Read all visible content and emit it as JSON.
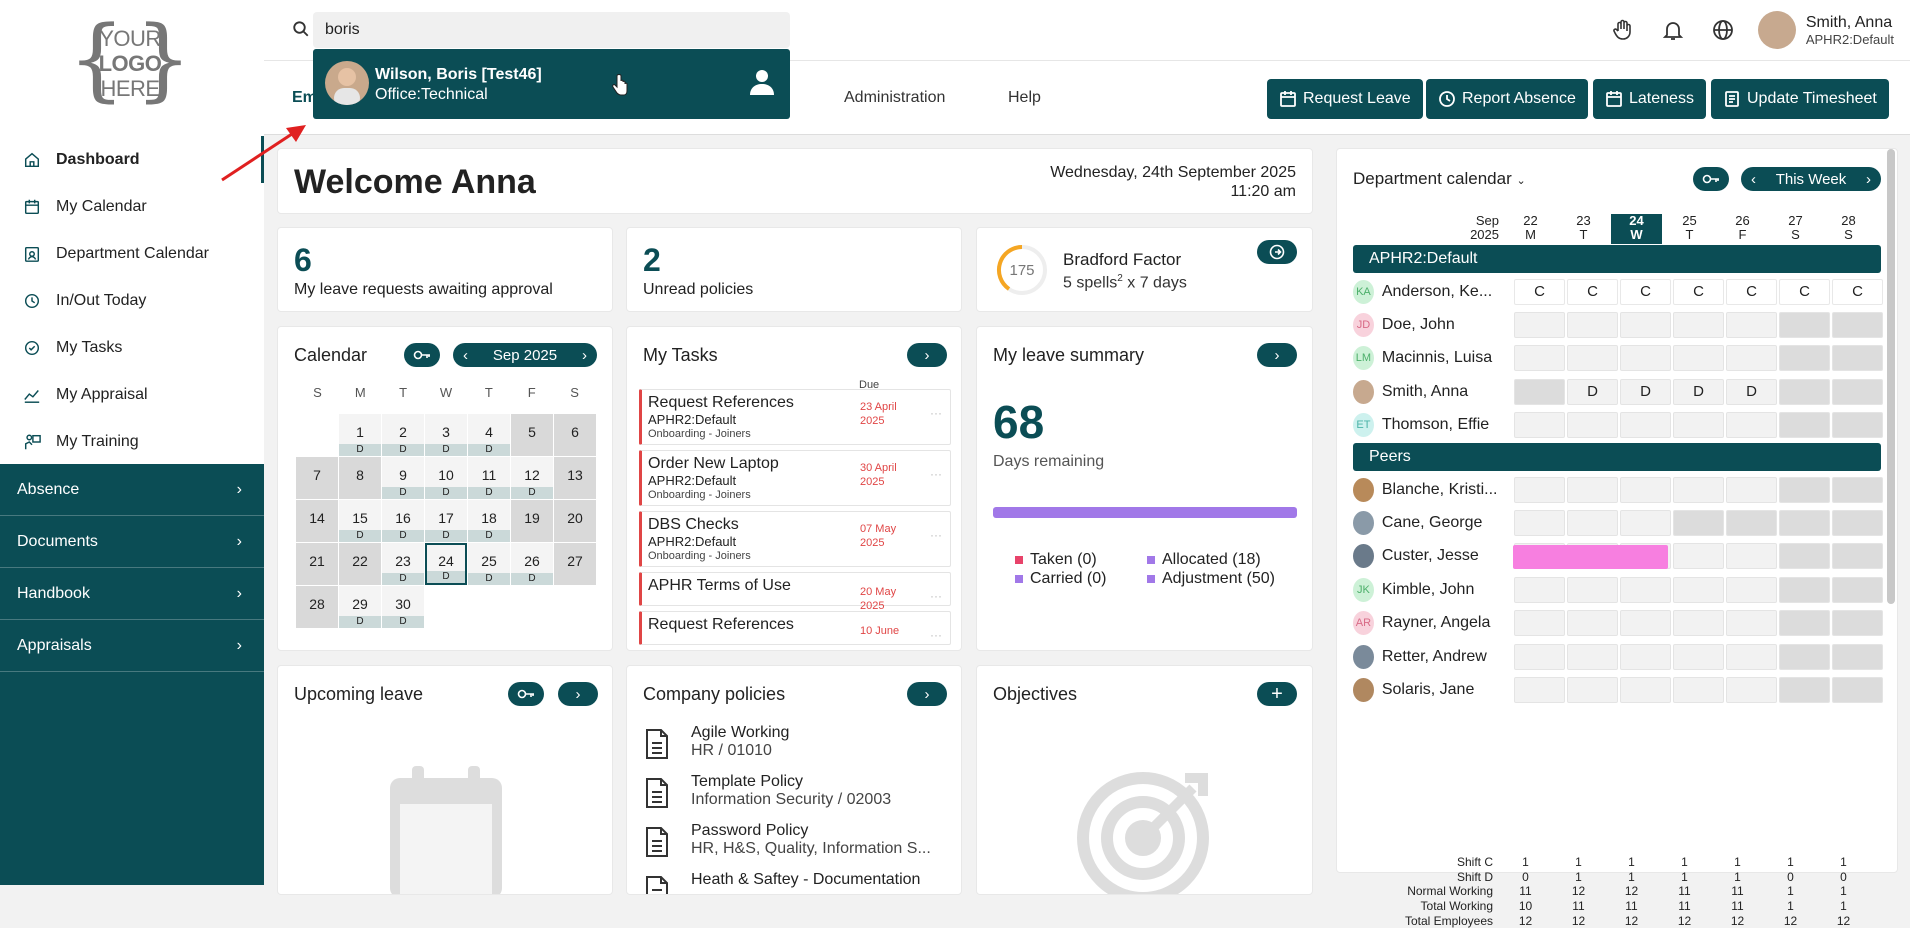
{
  "logo": {
    "line1": "YOUR",
    "line2": "LOGO",
    "line3": "HERE"
  },
  "sidebar": {
    "items": [
      {
        "label": "Dashboard",
        "icon": "home-icon",
        "active": true
      },
      {
        "label": "My Calendar",
        "icon": "calendar-icon"
      },
      {
        "label": "Department Calendar",
        "icon": "calendar-user-icon"
      },
      {
        "label": "In/Out Today",
        "icon": "history-icon"
      },
      {
        "label": "My Tasks",
        "icon": "check-circle-icon"
      },
      {
        "label": "My Appraisal",
        "icon": "chart-line-icon"
      },
      {
        "label": "My Training",
        "icon": "training-icon"
      }
    ],
    "sections": [
      "Absence",
      "Documents",
      "Handbook",
      "Appraisals"
    ]
  },
  "search": {
    "value": "boris"
  },
  "search_result": {
    "name": "Wilson, Boris [Test46]",
    "sub": "Office:Technical"
  },
  "user": {
    "name": "Smith, Anna",
    "role": "APHR2:Default"
  },
  "tabs": {
    "first_partial": "Em",
    "admin": "Administration",
    "help": "Help"
  },
  "actions": [
    "Request Leave",
    "Report Absence",
    "Lateness",
    "Update Timesheet"
  ],
  "welcome": {
    "title": "Welcome Anna",
    "date": "Wednesday, 24th September 2025",
    "time": "11:20 am"
  },
  "stats": {
    "leave_count": "6",
    "leave_label": "My leave requests awaiting approval",
    "policies_count": "2",
    "policies_label": "Unread policies",
    "bradford_score": "175",
    "bradford_title": "Bradford Factor",
    "bradford_spells": "5 spells",
    "bradford_sup": "2",
    "bradford_rest": " x 7 days"
  },
  "calendar": {
    "title": "Calendar",
    "month": "Sep 2025",
    "headers": [
      "S",
      "M",
      "T",
      "W",
      "T",
      "F",
      "S"
    ],
    "weeks": [
      [
        {
          "n": ""
        },
        {
          "n": "1",
          "d": true
        },
        {
          "n": "2",
          "d": true
        },
        {
          "n": "3",
          "d": true
        },
        {
          "n": "4",
          "d": true
        },
        {
          "n": "5",
          "we": true
        },
        {
          "n": "6",
          "we": true
        }
      ],
      [
        {
          "n": "7",
          "we": true
        },
        {
          "n": "8",
          "we": true
        },
        {
          "n": "9",
          "d": true
        },
        {
          "n": "10",
          "d": true
        },
        {
          "n": "11",
          "d": true
        },
        {
          "n": "12",
          "d": true
        },
        {
          "n": "13",
          "we": true
        }
      ],
      [
        {
          "n": "14",
          "we": true
        },
        {
          "n": "15",
          "d": true
        },
        {
          "n": "16",
          "d": true
        },
        {
          "n": "17",
          "d": true
        },
        {
          "n": "18",
          "d": true
        },
        {
          "n": "19",
          "we": true
        },
        {
          "n": "20",
          "we": true
        }
      ],
      [
        {
          "n": "21",
          "we": true
        },
        {
          "n": "22",
          "we": true
        },
        {
          "n": "23",
          "d": true
        },
        {
          "n": "24",
          "d": true,
          "today": true
        },
        {
          "n": "25",
          "d": true
        },
        {
          "n": "26",
          "d": true
        },
        {
          "n": "27",
          "we": true
        }
      ],
      [
        {
          "n": "28",
          "we": true
        },
        {
          "n": "29",
          "d": true
        },
        {
          "n": "30",
          "d": true
        },
        {
          "n": ""
        },
        {
          "n": ""
        },
        {
          "n": ""
        },
        {
          "n": ""
        }
      ]
    ],
    "day_marker": "D"
  },
  "tasks": {
    "title": "My Tasks",
    "due_label": "Due",
    "items": [
      {
        "title": "Request References",
        "sub": "APHR2:Default",
        "sub2": "Onboarding - Joiners",
        "due": "23 April 2025"
      },
      {
        "title": "Order New Laptop",
        "sub": "APHR2:Default",
        "sub2": "Onboarding - Joiners",
        "due": "30 April 2025"
      },
      {
        "title": "DBS Checks",
        "sub": "APHR2:Default",
        "sub2": "Onboarding - Joiners",
        "due": "07 May 2025"
      },
      {
        "title": "APHR Terms of Use",
        "sub": "",
        "sub2": "",
        "due": "20 May 2025"
      },
      {
        "title": "Request References",
        "sub": "",
        "sub2": "",
        "due": "10 June"
      }
    ]
  },
  "leave_summary": {
    "title": "My leave summary",
    "days": "68",
    "days_label": "Days remaining",
    "taken": "Taken (0)",
    "carried": "Carried (0)",
    "allocated": "Allocated (18)",
    "adjustment": "Adjustment (50)",
    "colors": {
      "taken": "#e8436a",
      "carried": "#a178e8",
      "allocated": "#a178e8",
      "adjustment": "#a178e8",
      "bar": "#a178e8"
    }
  },
  "upcoming": {
    "title": "Upcoming leave"
  },
  "policies": {
    "title": "Company policies",
    "items": [
      {
        "title": "Agile Working",
        "sub": "HR / 01010"
      },
      {
        "title": "Template Policy",
        "sub": "Information Security / 02003"
      },
      {
        "title": "Password Policy",
        "sub": "HR, H&S, Quality, Information S..."
      },
      {
        "title": "Heath & Saftey - Documentation",
        "sub": ""
      }
    ]
  },
  "objectives": {
    "title": "Objectives"
  },
  "dept": {
    "title": "Department calendar",
    "range": "This Week",
    "month": "Sep",
    "year": "2025",
    "days": [
      {
        "n": "22",
        "l": "M"
      },
      {
        "n": "23",
        "l": "T"
      },
      {
        "n": "24",
        "l": "W",
        "today": true
      },
      {
        "n": "25",
        "l": "T"
      },
      {
        "n": "26",
        "l": "F"
      },
      {
        "n": "27",
        "l": "S"
      },
      {
        "n": "28",
        "l": "S"
      }
    ],
    "group1": "APHR2:Default",
    "group1_rows": [
      {
        "name": "Anderson, Ke...",
        "ini": "KA",
        "bg": "#cdf1d7",
        "fg": "#4caf6a",
        "cells": [
          "C",
          "C",
          "C",
          "C",
          "C",
          "C",
          "C"
        ],
        "type": "c"
      },
      {
        "name": "Doe, John",
        "ini": "JD",
        "bg": "#f8d2dc",
        "fg": "#d86a86",
        "cells": [
          "",
          "",
          "",
          "",
          "",
          "",
          ""
        ]
      },
      {
        "name": "Macinnis, Luisa",
        "ini": "LM",
        "bg": "#cdf1d7",
        "fg": "#4caf6a",
        "cells": [
          "",
          "",
          "",
          "",
          "",
          "",
          ""
        ]
      },
      {
        "name": "Smith, Anna",
        "ini": "",
        "bg": "#c7a98f",
        "fg": "#fff",
        "cells": [
          "",
          "D",
          "D",
          "D",
          "D",
          "",
          ""
        ],
        "smith": true
      },
      {
        "name": "Thomson, Effie",
        "ini": "ET",
        "bg": "#cdf1ee",
        "fg": "#4cb3a8",
        "cells": [
          "",
          "",
          "",
          "",
          "",
          "",
          ""
        ]
      }
    ],
    "group2": "Peers",
    "group2_rows": [
      {
        "name": "Blanche, Kristi...",
        "ini": "",
        "bg": "#b88a5a",
        "fg": "#fff",
        "cells": [
          "",
          "",
          "",
          "",
          "",
          "",
          ""
        ]
      },
      {
        "name": "Cane, George",
        "ini": "",
        "bg": "#8a9aa8",
        "fg": "#fff",
        "cells": [
          "",
          "",
          "",
          "",
          "",
          "",
          ""
        ],
        "cane": true
      },
      {
        "name": "Custer, Jesse",
        "ini": "",
        "bg": "#6a7a8a",
        "fg": "#fff",
        "cells": [
          "",
          "",
          "",
          "",
          "",
          "",
          ""
        ],
        "pink": true
      },
      {
        "name": "Kimble, John",
        "ini": "JK",
        "bg": "#cdf1d7",
        "fg": "#4caf6a",
        "cells": [
          "",
          "",
          "",
          "",
          "",
          "",
          ""
        ]
      },
      {
        "name": "Rayner, Angela",
        "ini": "AR",
        "bg": "#f8d2dc",
        "fg": "#d86a86",
        "cells": [
          "",
          "",
          "",
          "",
          "",
          "",
          ""
        ]
      },
      {
        "name": "Retter, Andrew",
        "ini": "",
        "bg": "#7a8a9a",
        "fg": "#fff",
        "cells": [
          "",
          "",
          "",
          "",
          "",
          "",
          ""
        ]
      },
      {
        "name": "Solaris, Jane",
        "ini": "",
        "bg": "#b08860",
        "fg": "#fff",
        "cells": [
          "",
          "",
          "",
          "",
          "",
          "",
          ""
        ]
      }
    ],
    "pink_color": "#f77fe0",
    "stats": [
      {
        "label": "Shift C",
        "vals": [
          "1",
          "1",
          "1",
          "1",
          "1",
          "1",
          "1"
        ]
      },
      {
        "label": "Shift D",
        "vals": [
          "0",
          "1",
          "1",
          "1",
          "1",
          "0",
          "0"
        ]
      },
      {
        "label": "Normal Working",
        "vals": [
          "11",
          "12",
          "12",
          "11",
          "11",
          "1",
          "1"
        ]
      },
      {
        "label": "Total Working",
        "vals": [
          "10",
          "11",
          "11",
          "11",
          "11",
          "1",
          "1"
        ]
      },
      {
        "label": "Total Employees",
        "vals": [
          "12",
          "12",
          "12",
          "12",
          "12",
          "12",
          "12"
        ]
      }
    ]
  }
}
